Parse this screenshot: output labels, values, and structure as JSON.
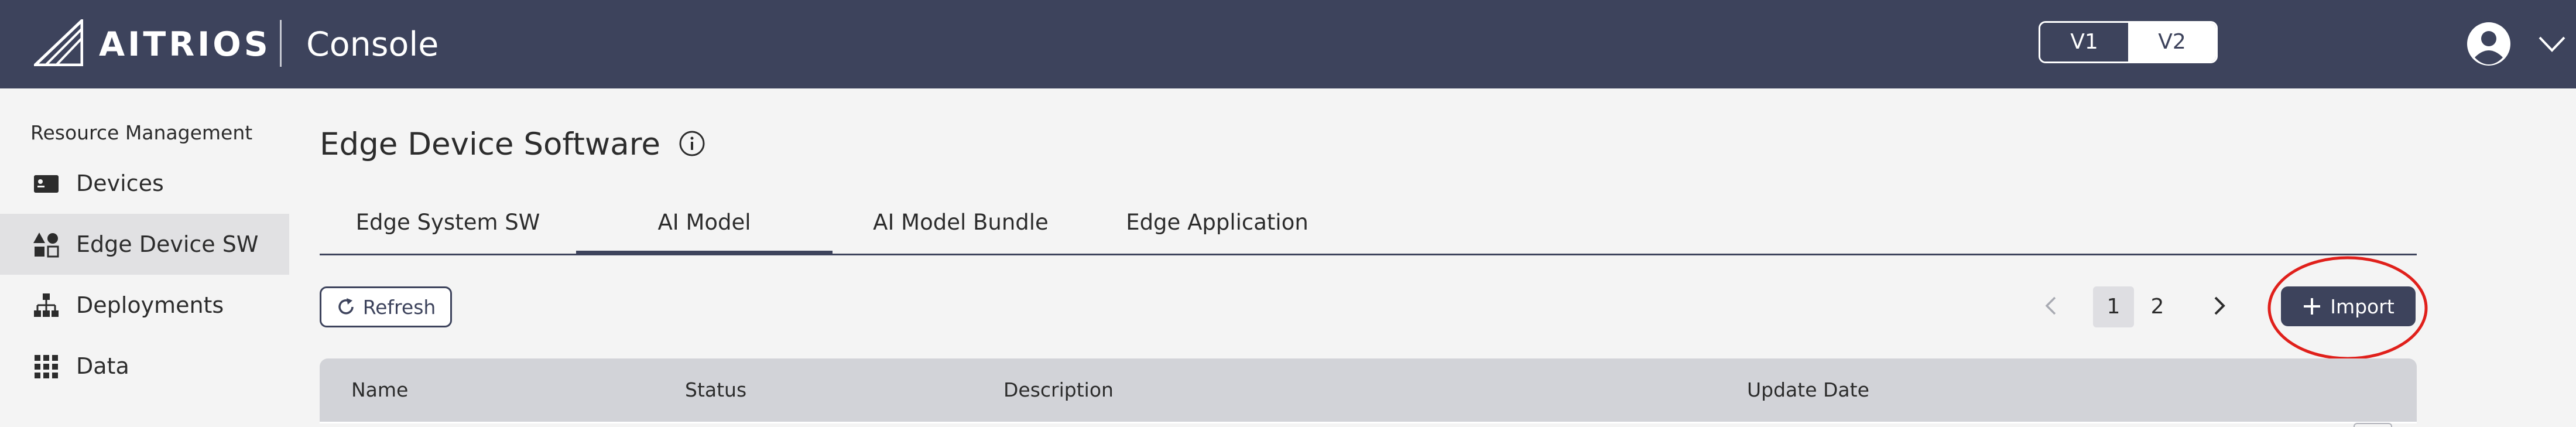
{
  "header": {
    "brand": "AITRIOS",
    "product": "Console",
    "version_options": [
      "V1",
      "V2"
    ],
    "selected_version": "V2",
    "icons": {
      "logo": "aitrios-logo-icon",
      "user": "user-avatar-icon",
      "menu": "chevron-down-icon"
    }
  },
  "sidebar": {
    "heading": "Resource Management",
    "items": [
      {
        "label": "Devices",
        "icon": "device-card-icon",
        "active": false
      },
      {
        "label": "Edge Device SW",
        "icon": "shapes-icon",
        "active": true
      },
      {
        "label": "Deployments",
        "icon": "hierarchy-icon",
        "active": false
      },
      {
        "label": "Data",
        "icon": "grid-icon",
        "active": false
      }
    ]
  },
  "main": {
    "title": "Edge Device Software",
    "tabs": [
      {
        "label": "Edge System SW",
        "active": false
      },
      {
        "label": "AI Model",
        "active": true
      },
      {
        "label": "AI Model Bundle",
        "active": false
      },
      {
        "label": "Edge Application",
        "active": false
      }
    ],
    "toolbar": {
      "refresh_label": "Refresh",
      "import_label": "Import"
    },
    "pagination": {
      "pages": [
        "1",
        "2"
      ],
      "current": "1"
    },
    "table": {
      "columns": [
        "Name",
        "Status",
        "Description",
        "Update Date"
      ]
    }
  },
  "colors": {
    "header_bg": "#3d435c",
    "page_bg": "#f4f4f4",
    "accent": "#3d435c",
    "table_header_bg": "#d2d3d8",
    "highlight": "#e0201b"
  }
}
